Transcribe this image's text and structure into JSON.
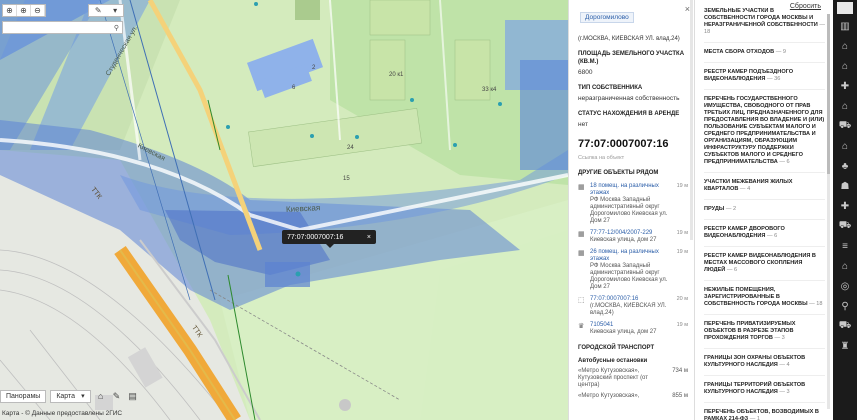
{
  "map": {
    "zoom_buttons": [
      "⊕",
      "⊕",
      "⊖"
    ],
    "dropdown_label": "▾",
    "search_icon": "search-icon",
    "streets": {
      "studencheskaya": "Студенческая ул.",
      "kievskaya_diag": "Киевская",
      "kievskaya": "Киевская",
      "ttk_top": "ТТК",
      "ttk_bottom": "ТТК"
    },
    "building_numbers": [
      "2",
      "6",
      "20 к1",
      "24",
      "15",
      "22 к3",
      "33 к4"
    ],
    "tooltip": {
      "text": "77:07:0007007:16",
      "close": "×"
    },
    "panoramas": "Панорамы",
    "map_type": "Карта",
    "copyright": "Карта - © Данные предоставлены 2ГИС",
    "scale_text": "100 м"
  },
  "info": {
    "tag": "Дорогомилово",
    "close": "×",
    "address": "(г.МОСКВА, КИЕВСКАЯ УЛ. влад.24)",
    "area_label": "ПЛОЩАДЬ ЗЕМЕЛЬНОГО УЧАСТКА (КВ.М.)",
    "area_value": "6800",
    "ownership_label": "ТИП СОБСТВЕННИКА",
    "ownership_value": "неразграниченная собственность",
    "rent_label": "СТАТУС НАХОЖДЕНИЯ В АРЕНДЕ",
    "rent_value": "нет",
    "cadastral": "77:07:0007007:16",
    "link": "Ссылка на объект",
    "nearby_label": "ДРУГИЕ ОБЪЕКТЫ РЯДОМ",
    "nearby": [
      {
        "link": "18 помещ. на различных этажах",
        "text": "РФ Москва Западный административный округ Дорогомилово Киевская ул. Дом 27",
        "dist": "19 м"
      },
      {
        "link": "77:77-12/004/2007-229",
        "text": "Киевская улица, дом 27",
        "dist": "19 м"
      },
      {
        "link": "26 помещ. на различных этажах",
        "text": "РФ Москва Западный административный округ Дорогомилово Киевская ул. Дом 27",
        "dist": "19 м"
      },
      {
        "link": "77:07:0007007:16",
        "text": "(г.МОСКВА, КИЕВСКАЯ УЛ. влад.24)",
        "dist": "20 м"
      },
      {
        "link": "7105041",
        "text": "Киевская улица, дом 27",
        "dist": "19 м"
      }
    ],
    "transport_label": "ГОРОДСКОЙ ТРАНСПОРТ",
    "stops_label": "Автобусные остановки",
    "stops": [
      {
        "name": "«Метро Кутузовская», Кутузовский проспект (от центра)",
        "dist": "734 м"
      },
      {
        "name": "«Метро Кутузовская»,",
        "dist": "855 м"
      }
    ]
  },
  "layers": {
    "reset": "Сбросить",
    "items": [
      {
        "name": "ЗЕМЕЛЬНЫЕ УЧАСТКИ В СОБСТВЕННОСТИ ГОРОДА МОСКВЫ И НЕРАЗГРАНИЧЕННОЙ СОБСТВЕННОСТИ",
        "count": "— 18"
      },
      {
        "name": "МЕСТА СБОРА ОТХОДОВ",
        "count": "— 9"
      },
      {
        "name": "РЕЕСТР КАМЕР ПОДЪЕЗДНОГО ВИДЕОНАБЛЮДЕНИЯ",
        "count": "— 36"
      },
      {
        "name": "ПЕРЕЧЕНЬ ГОСУДАРСТВЕННОГО ИМУЩЕСТВА, СВОБОДНОГО ОТ ПРАВ ТРЕТЬИХ ЛИЦ, ПРЕДНАЗНАЧЕННОГО ДЛЯ ПРЕДОСТАВЛЕНИЯ ВО ВЛАДЕНИЕ И (ИЛИ) ПОЛЬЗОВАНИЕ СУБЪЕКТАМ МАЛОГО И СРЕДНЕГО ПРЕДПРИНИМАТЕЛЬСТВА И ОРГАНИЗАЦИЯМ, ОБРАЗУЮЩИМ ИНФРАСТРУКТУРУ ПОДДЕРЖКИ СУБЪЕКТОВ МАЛОГО И СРЕДНЕГО ПРЕДПРИНИМАТЕЛЬСТВА",
        "count": "— 6"
      },
      {
        "name": "УЧАСТКИ МЕЖЕВАНИЯ ЖИЛЫХ КВАРТАЛОВ",
        "count": "— 4"
      },
      {
        "name": "ПРУДЫ",
        "count": "— 2"
      },
      {
        "name": "РЕЕСТР КАМЕР ДВОРОВОГО ВИДЕОНАБЛЮДЕНИЯ",
        "count": "— 6"
      },
      {
        "name": "РЕЕСТР КАМЕР ВИДЕОНАБЛЮДЕНИЯ В МЕСТАХ МАССОВОГО СКОПЛЕНИЯ ЛЮДЕЙ",
        "count": "— 6"
      },
      {
        "name": "НЕЖИЛЫЕ ПОМЕЩЕНИЯ, ЗАРЕГИСТРИРОВАННЫЕ В СОБСТВЕННОСТЬ ГОРОДА МОСКВЫ",
        "count": "— 18"
      },
      {
        "name": "ПЕРЕЧЕНЬ ПРИВАТИЗИРУЕМЫХ ОБЪЕКТОВ В РАЗРЕЗЕ ЭТАПОВ ПРОХОЖДЕНИЯ ТОРГОВ",
        "count": "— 3"
      },
      {
        "name": "ГРАНИЦЫ ЗОН ОХРАНЫ ОБЪЕКТОВ КУЛЬТУРНОГО НАСЛЕДИЯ",
        "count": "— 4"
      },
      {
        "name": "ГРАНИЦЫ ТЕРРИТОРИЙ ОБЪЕКТОВ КУЛЬТУРНОГО НАСЛЕДИЯ",
        "count": "— 3"
      },
      {
        "name": "ПЕРЕЧЕНЬ ОБЪЕКТОВ, ВОЗВОДИМЫХ В РАМКАХ 214-ФЗ",
        "count": "— 1"
      }
    ]
  },
  "sidebar_icons": [
    "building-icon",
    "bank-icon",
    "factory-icon",
    "pharmacy-icon",
    "school-icon",
    "cart-icon",
    "hospital-icon",
    "tree-icon",
    "dog-icon",
    "cross-icon",
    "bus-icon",
    "road-icon",
    "fountain-icon",
    "wifi-icon",
    "bike-icon",
    "car-icon",
    "culture-icon"
  ]
}
